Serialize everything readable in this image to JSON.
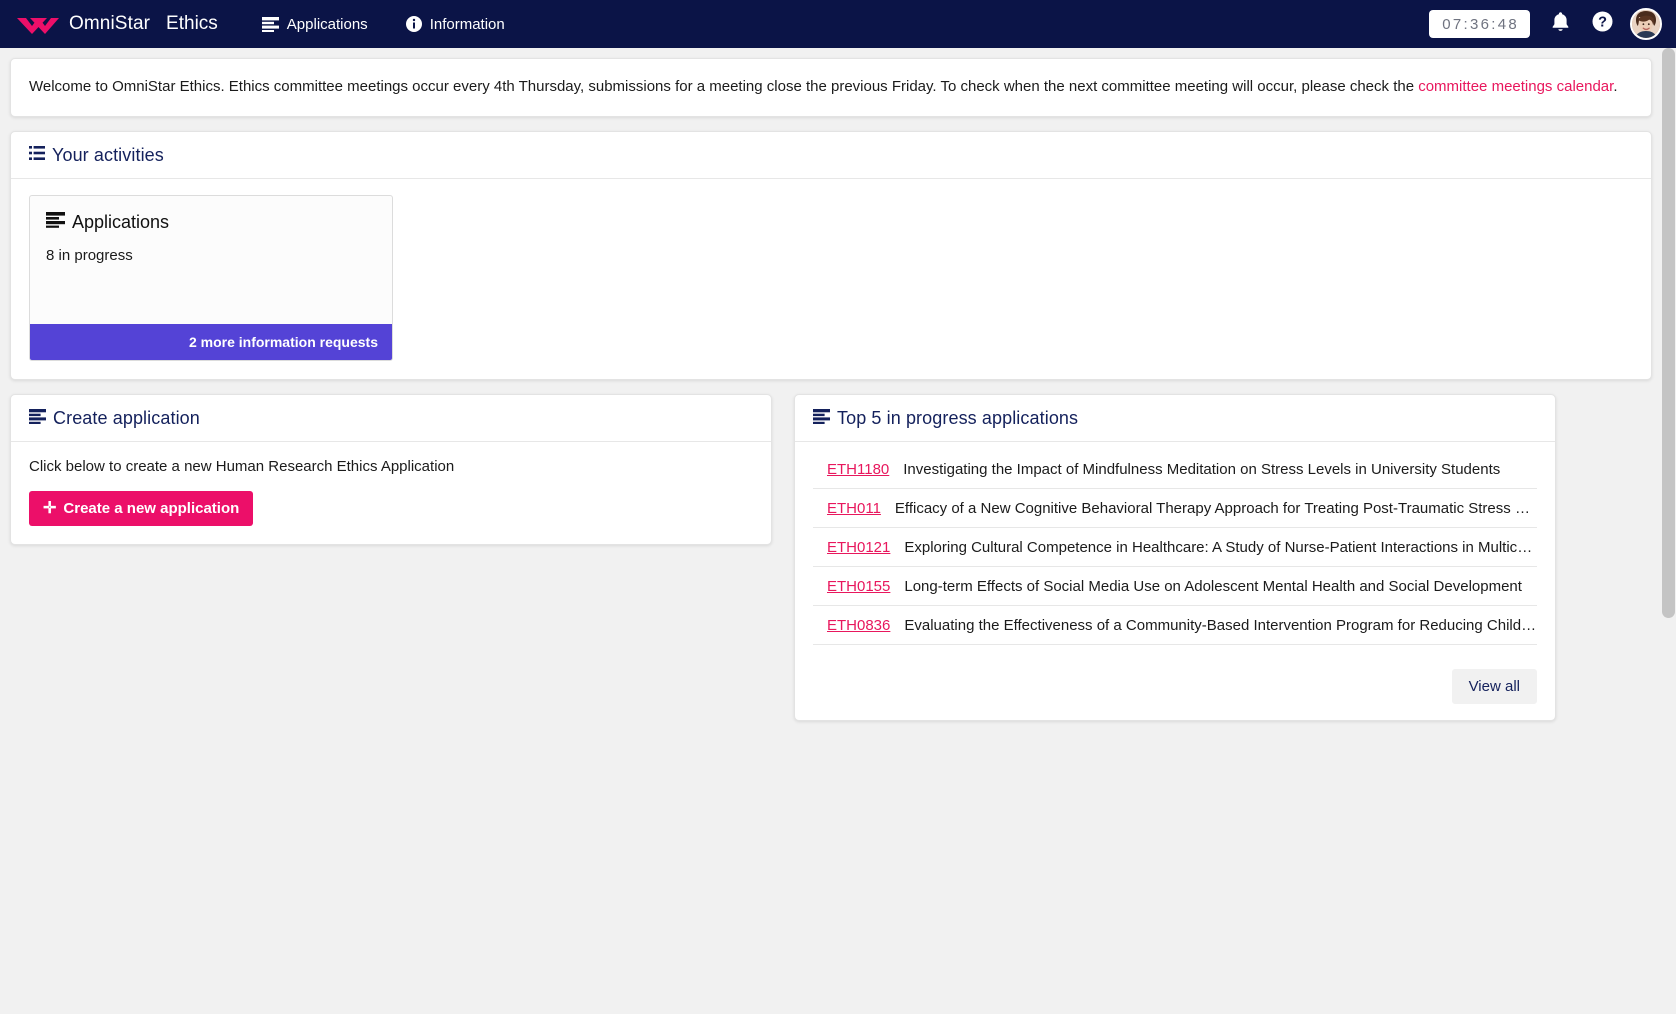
{
  "topnav": {
    "brand": "OmniStar",
    "product": "Ethics",
    "logo_icon": "omnistar-chevrons-logo",
    "links": [
      {
        "label": "Applications",
        "icon": "list-stack-icon"
      },
      {
        "label": "Information",
        "icon": "info-circle-icon"
      }
    ],
    "timer": "07:36:48",
    "notifications_icon": "bell-icon",
    "help_icon": "question-circle-icon",
    "avatar_icon": "user-avatar-photo",
    "brand_color": "#0b1447",
    "accent_color": "#ec0f69"
  },
  "welcome": {
    "text_before": "Welcome to OmniStar Ethics.  Ethics committee meetings occur every 4th Thursday, submissions for a meeting close the previous Friday.  To check when the next committee meeting will occur, please check the ",
    "link": "committee meetings calendar",
    "text_after": "."
  },
  "activities": {
    "title": "Your activities",
    "icon": "list-lines-icon",
    "tile": {
      "title": "Applications",
      "icon": "list-stack-icon",
      "subtitle": "8 in progress",
      "footer_label": "2 more information requests",
      "footer_color": "#5443d6"
    }
  },
  "create_application": {
    "title": "Create application",
    "icon": "list-stack-icon",
    "hint": "Click below to create a new Human Research Ethics Application",
    "button_label": "Create a new application",
    "button_icon": "plus-icon"
  },
  "top_applications": {
    "title": "Top 5 in progress applications",
    "icon": "list-stack-icon",
    "rows": [
      {
        "code": "ETH1180",
        "title": "Investigating the Impact of Mindfulness Meditation on Stress Levels in University Students"
      },
      {
        "code": "ETH011",
        "title": "Efficacy of a New Cognitive Behavioral Therapy Approach for Treating Post-Traumatic Stress Disorder"
      },
      {
        "code": "ETH0121",
        "title": "Exploring Cultural Competence in Healthcare: A Study of Nurse-Patient Interactions in Multicultural Settings"
      },
      {
        "code": "ETH0155",
        "title": "Long-term Effects of Social Media Use on Adolescent Mental Health and Social Development"
      },
      {
        "code": "ETH0836",
        "title": "Evaluating the Effectiveness of a Community-Based Intervention Program for Reducing Childhood Obesity"
      }
    ],
    "view_all_label": "View all"
  }
}
